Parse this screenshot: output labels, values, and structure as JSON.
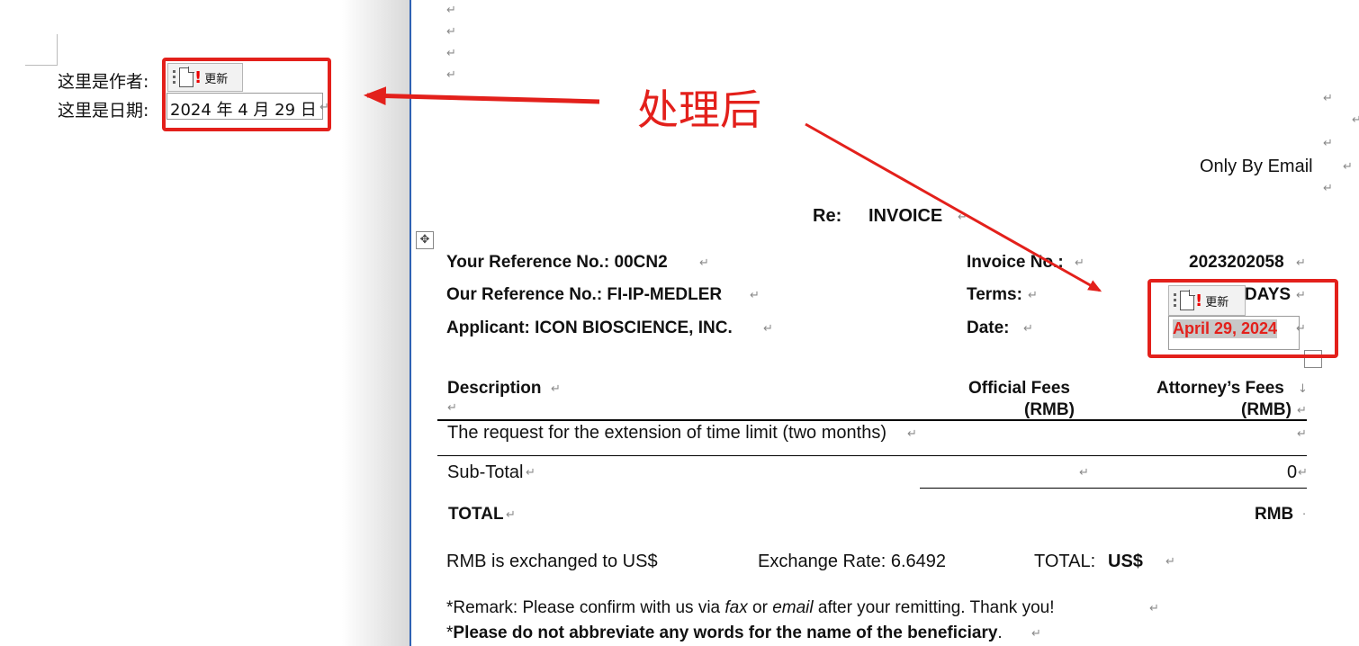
{
  "left_doc": {
    "author_label": "这里是作者:",
    "date_label": "这里是日期:",
    "date_field_value": "2024 年 4 月 29 日",
    "update_button_label": "更新"
  },
  "annotation": {
    "label": "处理后",
    "color": "#e3201b"
  },
  "para_mark": "↵",
  "right_doc": {
    "delivery": "Only By Email",
    "re_label": "Re:",
    "re_title": "INVOICE",
    "your_ref": "Your Reference No.: 00CN2",
    "our_ref": "Our Reference No.: FI-IP-MEDLER",
    "applicant": "Applicant: ICON BIOSCIENCE, INC.",
    "invoice_no_label": "Invoice No.:",
    "invoice_no_value": "2023202058",
    "terms_label": "Terms:",
    "terms_value": "DAYS",
    "date_label": "Date:",
    "date_value": "April 29, 2024",
    "update_button_label": "更新",
    "table": {
      "col_description": "Description",
      "col_official": "Official Fees",
      "col_official_unit": "(RMB)",
      "col_attorney": "Attorney’s Fees",
      "col_attorney_unit": "(RMB)",
      "row_item": "The request for the extension of time limit (two months)",
      "subtotal_label": "Sub-Total",
      "subtotal_attorney": "0",
      "total_label": "TOTAL",
      "total_currency": "RMB"
    },
    "exchange_text": "RMB is exchanged to US$",
    "exchange_rate": "Exchange Rate: 6.6492",
    "total_usd_label": "TOTAL:",
    "total_usd_currency": "US$",
    "remark_prefix": "*Remark: Please confirm with us via ",
    "remark_fax": "fax",
    "remark_or": " or ",
    "remark_email": "email",
    "remark_suffix": " after your remitting. Thank you!",
    "note_star": "*",
    "note_text": "Please do not abbreviate any words for the name of the beneficiary",
    "note_period": "."
  },
  "colors": {
    "highlight": "#e3201b",
    "divider": "#2f62b3",
    "date_field_bg": "#c8c8c8"
  }
}
